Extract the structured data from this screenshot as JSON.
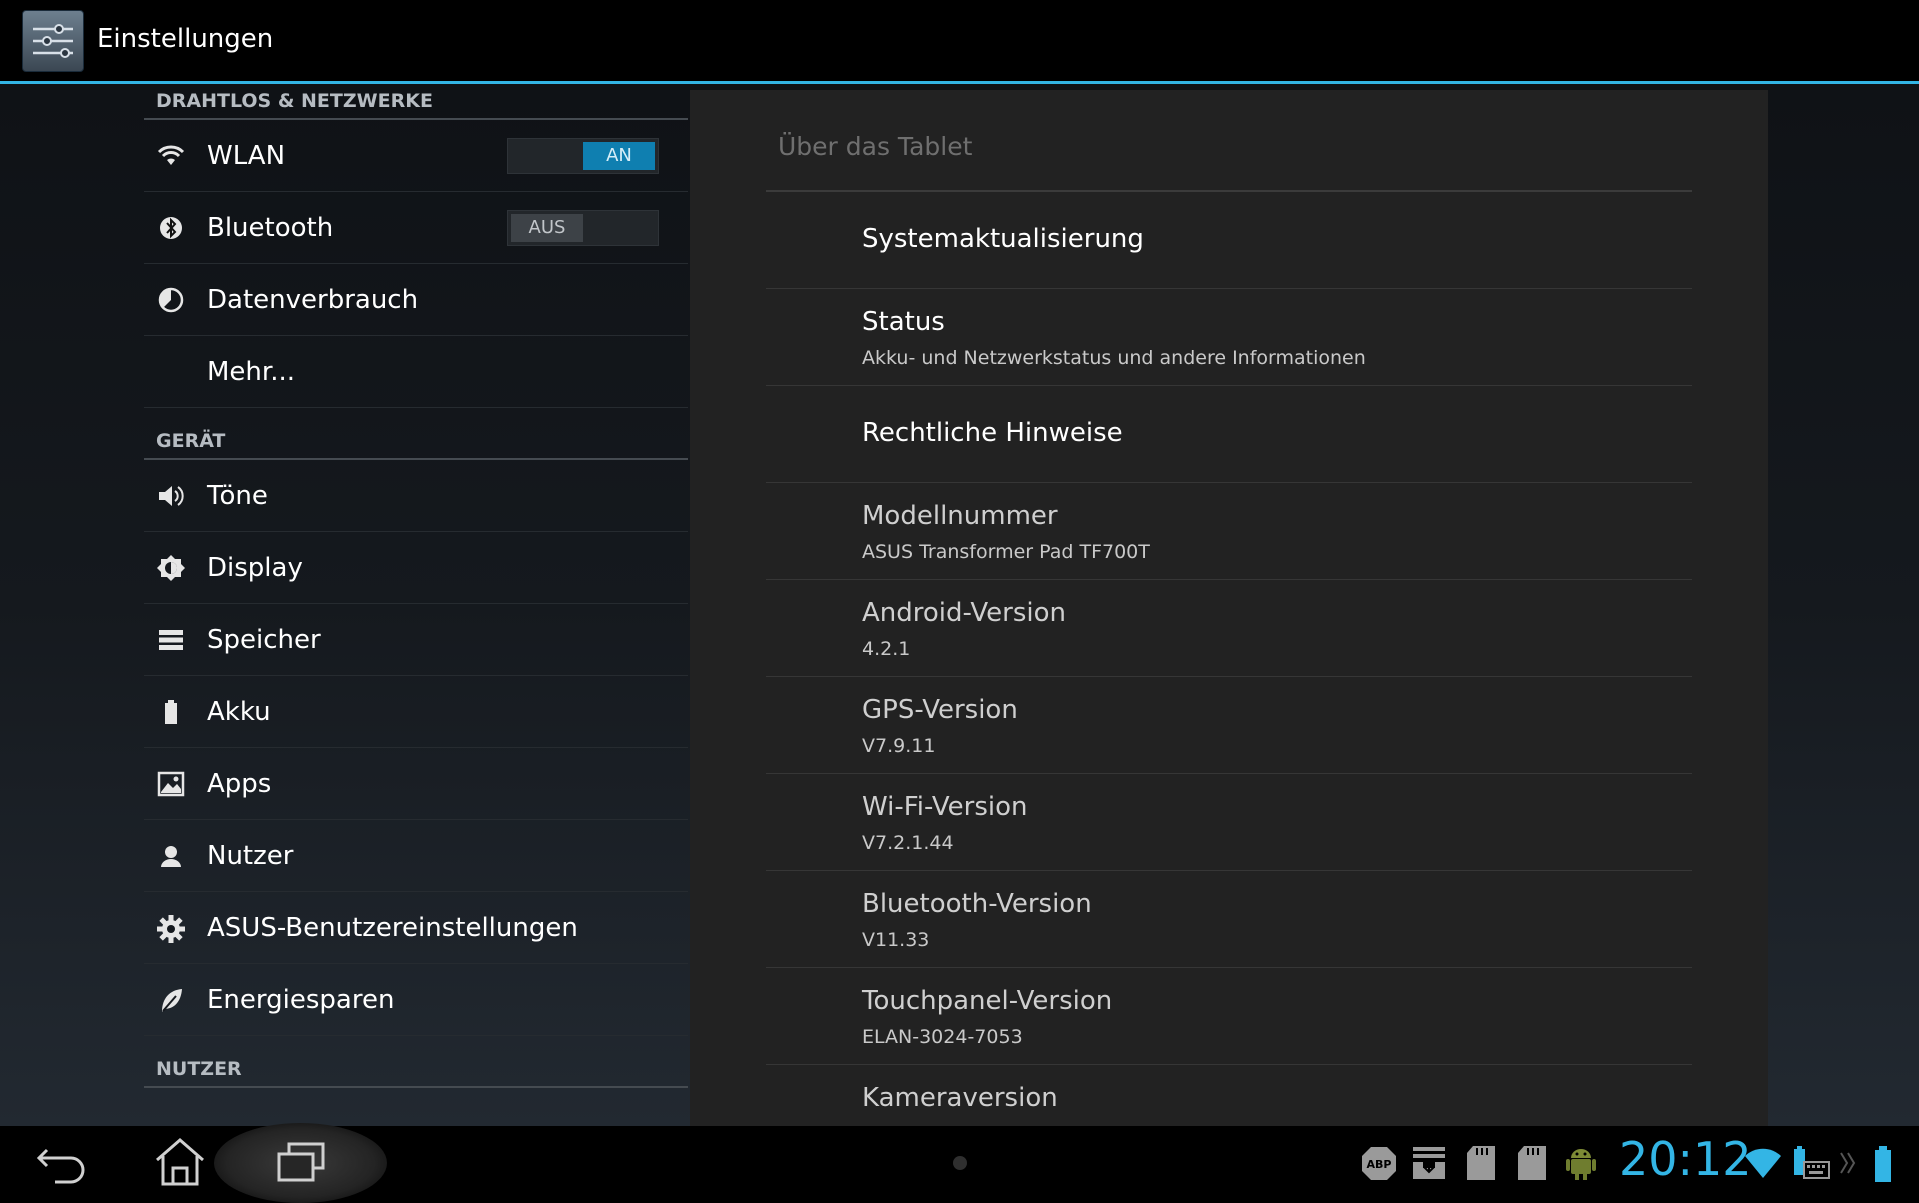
{
  "action_bar": {
    "app_icon": "settings-sliders-icon",
    "title": "Einstellungen"
  },
  "left_pane": {
    "headers": {
      "wireless": "DRAHTLOS & NETZWERKE",
      "device": "GERÄT",
      "personal": "NUTZER"
    },
    "items": [
      {
        "icon": "wifi-icon",
        "label": "WLAN",
        "toggle": "AN"
      },
      {
        "icon": "bluetooth-icon",
        "label": "Bluetooth",
        "toggle": "AUS"
      },
      {
        "icon": "data-usage-icon",
        "label": "Datenverbrauch"
      },
      {
        "icon": "",
        "label": "Mehr..."
      },
      {
        "icon": "sound-icon",
        "label": "Töne"
      },
      {
        "icon": "display-icon",
        "label": "Display"
      },
      {
        "icon": "storage-icon",
        "label": "Speicher"
      },
      {
        "icon": "battery-icon",
        "label": "Akku"
      },
      {
        "icon": "apps-icon",
        "label": "Apps"
      },
      {
        "icon": "user-icon",
        "label": "Nutzer"
      },
      {
        "icon": "gear-icon",
        "label": "ASUS-Benutzereinstellungen"
      },
      {
        "icon": "leaf-icon",
        "label": "Energiesparen"
      }
    ]
  },
  "right_pane": {
    "title": "Über das Tablet",
    "items": [
      {
        "title": "Systemaktualisierung",
        "summary": ""
      },
      {
        "title": "Status",
        "summary": "Akku- und Netzwerkstatus und andere Informationen"
      },
      {
        "title": "Rechtliche Hinweise",
        "summary": ""
      },
      {
        "title": "Modellnummer",
        "summary": "ASUS Transformer Pad TF700T"
      },
      {
        "title": "Android-Version",
        "summary": "4.2.1"
      },
      {
        "title": "GPS-Version",
        "summary": "V7.9.11"
      },
      {
        "title": "Wi-Fi-Version",
        "summary": "V7.2.1.44"
      },
      {
        "title": "Bluetooth-Version",
        "summary": "V11.33"
      },
      {
        "title": "Touchpanel-Version",
        "summary": "ELAN-3024-7053"
      },
      {
        "title": "Kameraversion",
        "summary": ""
      }
    ]
  },
  "nav_bar": {
    "buttons": [
      "back-icon",
      "home-icon",
      "recents-icon"
    ]
  },
  "status_bar": {
    "icons": [
      "adblock-icon",
      "download-icon",
      "sd-card-icon",
      "sd-card-icon",
      "android-icon"
    ],
    "clock": "20:12",
    "right_icons": [
      "wifi-signal-icon",
      "keyboard-battery-icon",
      "chevron-right-icon",
      "battery-icon"
    ]
  },
  "colors": {
    "accent": "#33b5e5",
    "toggle_on": "#0f7fb0",
    "background_pane": "#222222"
  }
}
